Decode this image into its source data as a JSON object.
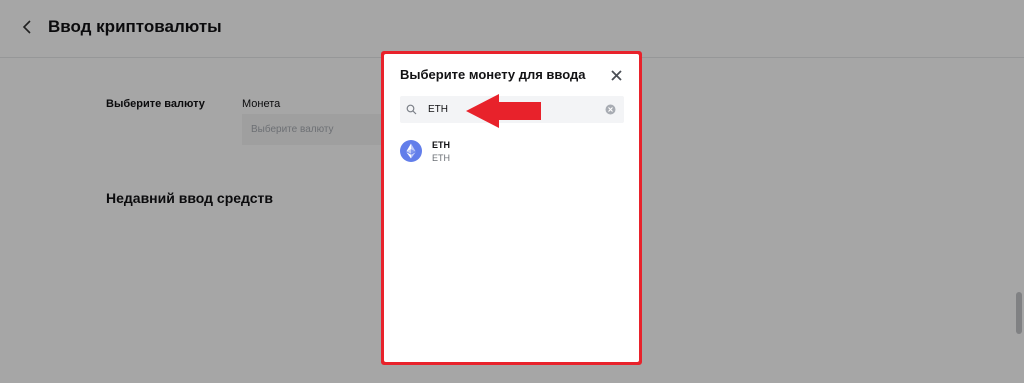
{
  "header": {
    "title": "Ввод криптовалюты"
  },
  "form": {
    "select_currency_label": "Выберите валюту",
    "coin_label": "Монета",
    "coin_placeholder": "Выберите валюту"
  },
  "recent": {
    "title": "Недавний ввод средств"
  },
  "modal": {
    "title": "Выберите монету для ввода",
    "search_value": "ETH",
    "results": [
      {
        "symbol": "ETH",
        "name": "ETH",
        "icon": "ethereum-icon"
      }
    ]
  },
  "colors": {
    "annotation_red": "#e8222b",
    "eth_blue": "#627eea"
  }
}
